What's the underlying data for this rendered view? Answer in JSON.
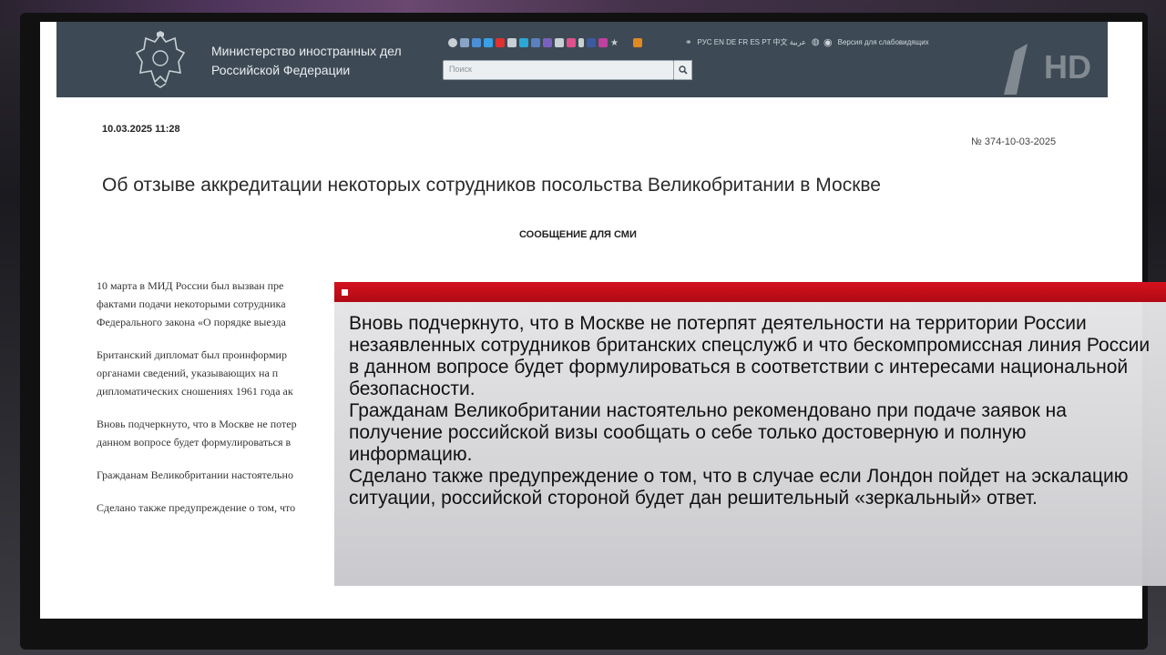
{
  "header": {
    "ministry_line1": "Министерство иностранных дел",
    "ministry_line2": "Российской Федерации",
    "languages": "РУС EN DE FR ES PT 中文 عربية",
    "accessibility_label": "Версия для слабовидящих",
    "search_placeholder": "Поиск",
    "social_icons": [
      "social-icon-1",
      "social-icon-2",
      "social-icon-3",
      "social-icon-4",
      "social-icon-5",
      "social-icon-6",
      "social-icon-7",
      "social-icon-8",
      "social-icon-9",
      "social-icon-10",
      "social-icon-11",
      "social-icon-12",
      "social-icon-13",
      "social-icon-14",
      "rss-icon"
    ]
  },
  "document": {
    "date": "10.03.2025 11:28",
    "number": "№ 374-10-03-2025",
    "title": "Об отзыве аккредитации некоторых сотрудников посольства Великобритании в Москве",
    "subtitle": "СООБЩЕНИЕ ДЛЯ СМИ",
    "paragraphs": [
      [
        "10 марта в МИД России был вызван пре",
        "фактами подачи некоторыми сотрудника",
        "Федерального закона «О порядке выезда"
      ],
      [
        "Британский дипломат был проинформир",
        "органами сведений, указывающих на п",
        "дипломатических сношениях 1961 года ак"
      ],
      [
        "Вновь подчеркнуто, что в Москве не потер",
        "данном вопросе будет формулироваться в"
      ],
      [
        "Гражданам Великобритании настоятельно"
      ],
      [
        "Сделано также предупреждение о том, что"
      ]
    ]
  },
  "channel_logo": "1 HD",
  "overlay": {
    "paragraphs": [
      "Вновь подчеркнуто, что в Москве не потерпят деятельности на территории России незаявленных сотрудников британских спецслужб и что бескомпромиссная линия России в данном вопросе будет формулироваться в соответствии с интересами национальной безопасности.",
      "Гражданам Великобритании настоятельно рекомендовано при подаче заявок на получение российской визы сообщать о себе только достоверную и полную информацию.",
      "Сделано также предупреждение о том, что в случае если Лондон пойдет на эскалацию ситуации, российской стороной будет дан решительный «зеркальный» ответ."
    ]
  },
  "colors": {
    "header_bg": "#3d4a55",
    "overlay_red": "#c8101a",
    "overlay_bg": "#d8d8db"
  }
}
